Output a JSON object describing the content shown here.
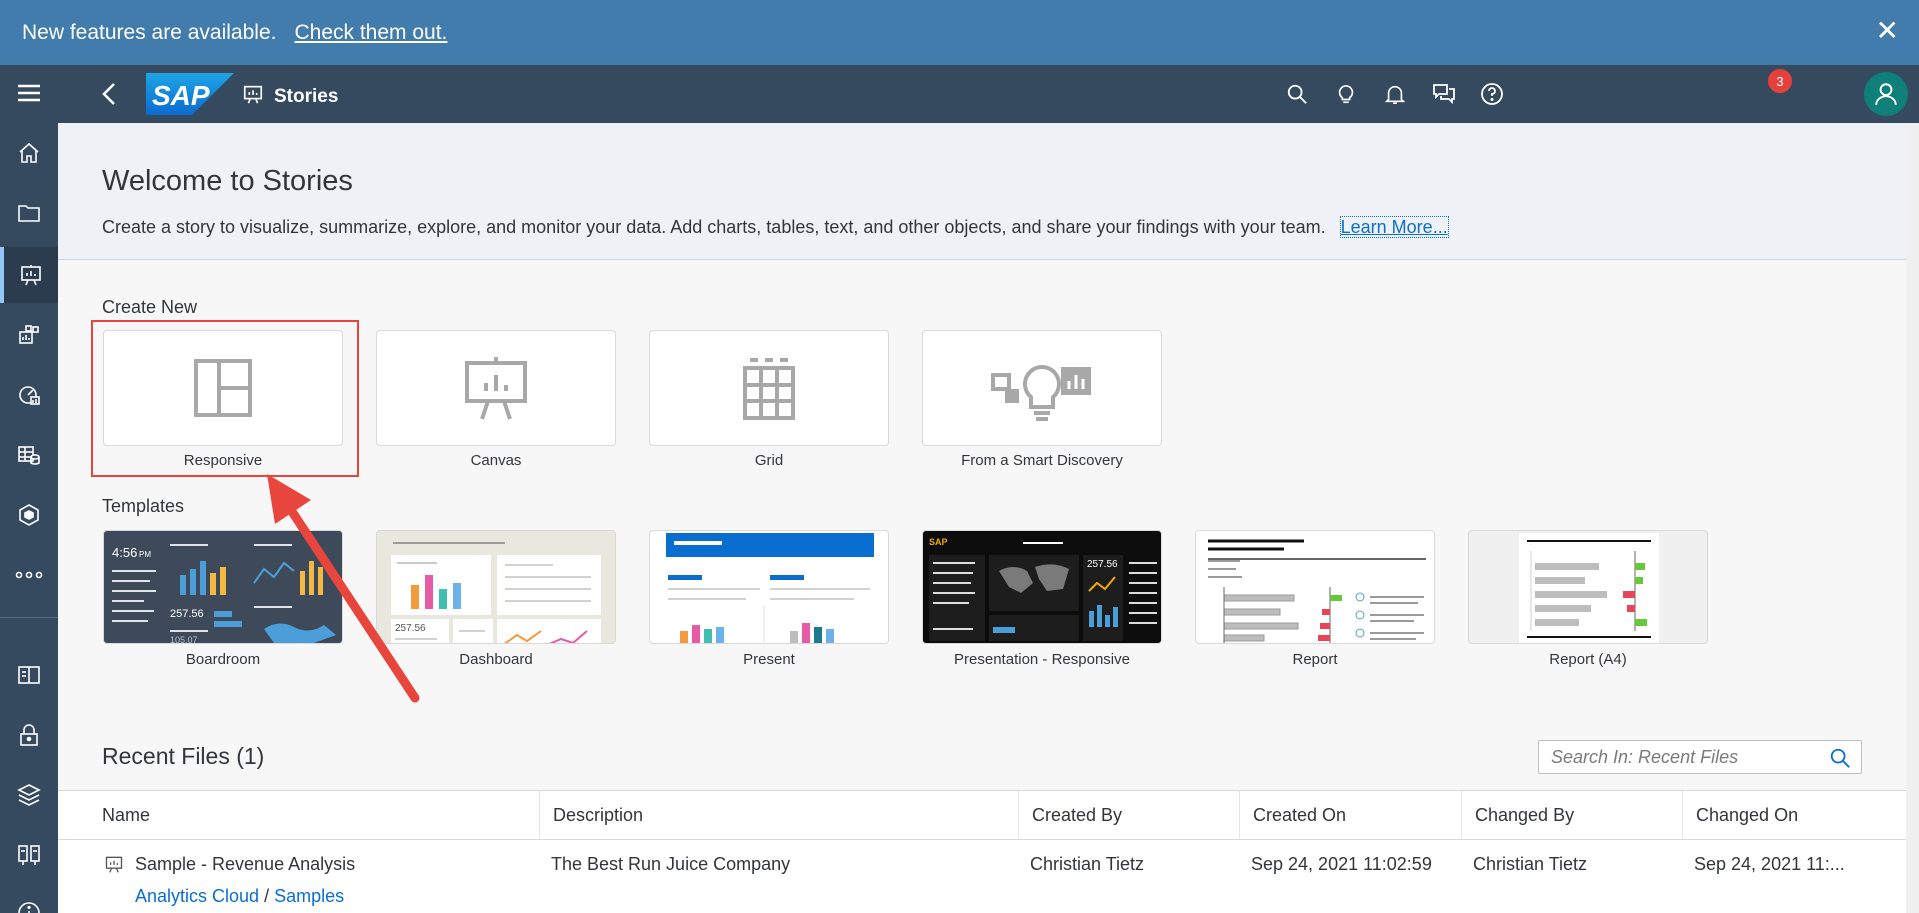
{
  "banner": {
    "text": "New features are available.",
    "link": "Check them out.",
    "close_symbol": "✕"
  },
  "shell": {
    "logo_text": "SAP",
    "title": "Stories",
    "notification_count": "3"
  },
  "welcome": {
    "title": "Welcome to Stories",
    "description": "Create a story to visualize, summarize, explore, and monitor your data. Add charts, tables, text, and other objects, and share your findings with your team.",
    "learn_more": "Learn More..."
  },
  "create_new": {
    "label": "Create New",
    "tiles": [
      {
        "label": "Responsive",
        "icon": "responsive-layout-icon"
      },
      {
        "label": "Canvas",
        "icon": "canvas-presentation-icon"
      },
      {
        "label": "Grid",
        "icon": "grid-table-icon"
      },
      {
        "label": "From a Smart Discovery",
        "icon": "smart-discovery-icon"
      }
    ]
  },
  "templates": {
    "label": "Templates",
    "items": [
      {
        "label": "Boardroom",
        "preview_time": "4:56",
        "preview_time_suffix": "PM",
        "preview_values": [
          "257.56",
          "105.07"
        ]
      },
      {
        "label": "Dashboard",
        "preview_values": [
          "257.56"
        ]
      },
      {
        "label": "Present"
      },
      {
        "label": "Presentation - Responsive",
        "preview_logo": "SAP",
        "preview_values": [
          "257.56"
        ]
      },
      {
        "label": "Report"
      },
      {
        "label": "Report (A4)"
      }
    ]
  },
  "recent": {
    "title": "Recent Files (1)",
    "search_placeholder": "Search In: Recent Files",
    "columns": [
      "Name",
      "Description",
      "Created By",
      "Created On",
      "Changed By",
      "Changed On"
    ],
    "rows": [
      {
        "name": "Sample - Revenue Analysis",
        "description": "The Best Run Juice Company",
        "created_by": "Christian Tietz",
        "created_on": "Sep 24, 2021 11:02:59",
        "changed_by": "Christian Tietz",
        "changed_on": "Sep 24, 2021 11:...",
        "path_root": "Analytics Cloud",
        "path_sep": "/",
        "path_folder": "Samples"
      }
    ]
  },
  "colors": {
    "banner": "#427cac",
    "shell": "#354a5f",
    "link": "#0a6ed1",
    "highlight": "#e8453c",
    "badge": "#e5403a",
    "avatar": "#0f7f7a"
  }
}
